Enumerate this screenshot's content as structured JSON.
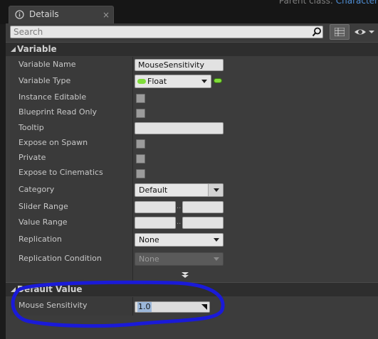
{
  "window": {
    "parent_class_label": "Parent class:",
    "parent_class_value": "Character",
    "tab_title": "Details",
    "tab_close": "×"
  },
  "search": {
    "placeholder": "Search",
    "icon": "search-icon"
  },
  "toolbar": {
    "view_options_icon": "list-view-icon",
    "visibility_icon": "eye-icon"
  },
  "variable_section": {
    "title": "Variable",
    "rows": {
      "variable_name": {
        "label": "Variable Name",
        "value": "MouseSensitivity"
      },
      "variable_type": {
        "label": "Variable Type",
        "value": "Float",
        "pin_color": "#7fdc3a"
      },
      "instance_editable": {
        "label": "Instance Editable",
        "checked": false
      },
      "blueprint_read_only": {
        "label": "Blueprint Read Only",
        "checked": false
      },
      "tooltip": {
        "label": "Tooltip",
        "value": ""
      },
      "expose_on_spawn": {
        "label": "Expose on Spawn",
        "checked": false
      },
      "private": {
        "label": "Private",
        "checked": false
      },
      "expose_to_cinematics": {
        "label": "Expose to Cinematics",
        "checked": false
      },
      "category": {
        "label": "Category",
        "value": "Default"
      },
      "slider_range": {
        "label": "Slider Range",
        "min": "",
        "max": "",
        "separator": ".."
      },
      "value_range": {
        "label": "Value Range",
        "min": "",
        "max": "",
        "separator": ".."
      },
      "replication": {
        "label": "Replication",
        "value": "None"
      },
      "replication_condition": {
        "label": "Replication Condition",
        "value": "None"
      }
    }
  },
  "default_section": {
    "title": "Default Value",
    "rows": {
      "mouse_sensitivity": {
        "label": "Mouse Sensitivity",
        "value": "1.0"
      }
    }
  },
  "annotation": {
    "color": "#1a1ad8"
  },
  "colors": {
    "panel_bg": "#3c3c3c",
    "header_bg": "#2e2e2e",
    "link_blue": "#4f8fd6"
  }
}
